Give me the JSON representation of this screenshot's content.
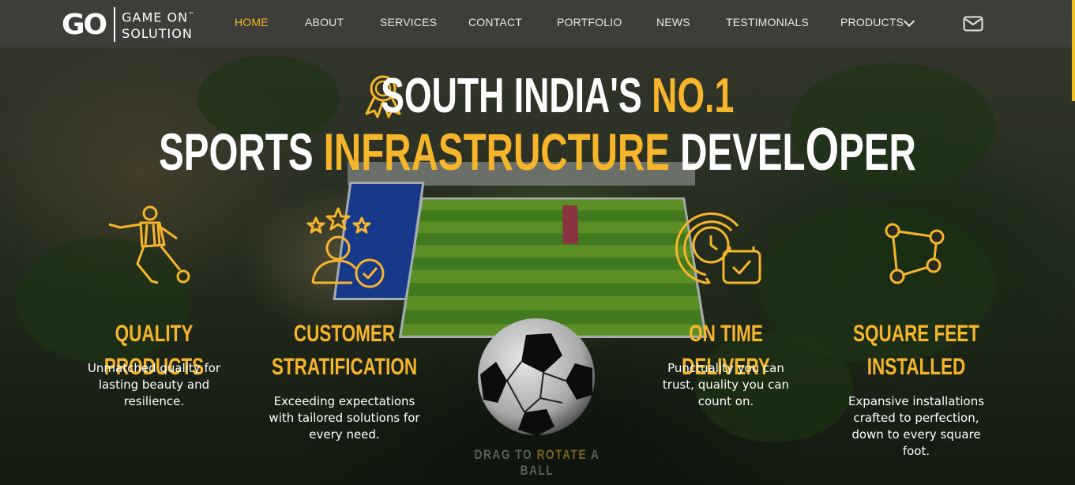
{
  "brand": {
    "logo_mark": "GO",
    "logo_line1": "GAME ON",
    "logo_tm": "™",
    "logo_line2": "SOLUTION"
  },
  "nav": {
    "items": [
      {
        "label": "HOME",
        "active": true
      },
      {
        "label": "ABOUT"
      },
      {
        "label": "SERVICES"
      },
      {
        "label": "CONTACT"
      },
      {
        "label": "PORTFOLIO"
      },
      {
        "label": "NEWS"
      },
      {
        "label": "TESTIMONIALS"
      },
      {
        "label": "PRODUCTS"
      }
    ],
    "products_dropdown_icon": "chevron-down-icon",
    "mail_icon": "mail-icon"
  },
  "headline": {
    "line1_white": "SOUTH INDIA'S",
    "line1_gold": "NO.1",
    "line2_white1": "SPORTS",
    "line2_gold": "INFRASTRUCTURE",
    "line2_white2a": "DEVEL",
    "line2_o": "O",
    "line2_white2b": "PER"
  },
  "features": [
    {
      "icon": "football-player-icon",
      "title": "QUALITY PRODUCTS",
      "desc": "Unmatched quality for lasting beauty and resilience."
    },
    {
      "icon": "customer-stars-icon",
      "title_line1": "CUSTOMER",
      "title_line2": "STRATIFICATION",
      "desc": "Exceeding expectations with tailored solutions for every need."
    },
    {
      "icon": "clock-check-icon",
      "title": "ON TIME DELIVERY",
      "desc": "Punctuality you can trust, quality you can count on."
    },
    {
      "icon": "area-polygon-icon",
      "title_line1": "SQUARE FEET",
      "title_line2": "INSTALLED",
      "desc": "Expansive installations crafted to perfection, down to every square foot."
    }
  ],
  "ball": {
    "drag_pre": "DRAG TO",
    "drag_hl": "ROTATE",
    "drag_post": "A BALL"
  },
  "colors": {
    "accent": "#f7b52b",
    "text": "#ffffff"
  }
}
